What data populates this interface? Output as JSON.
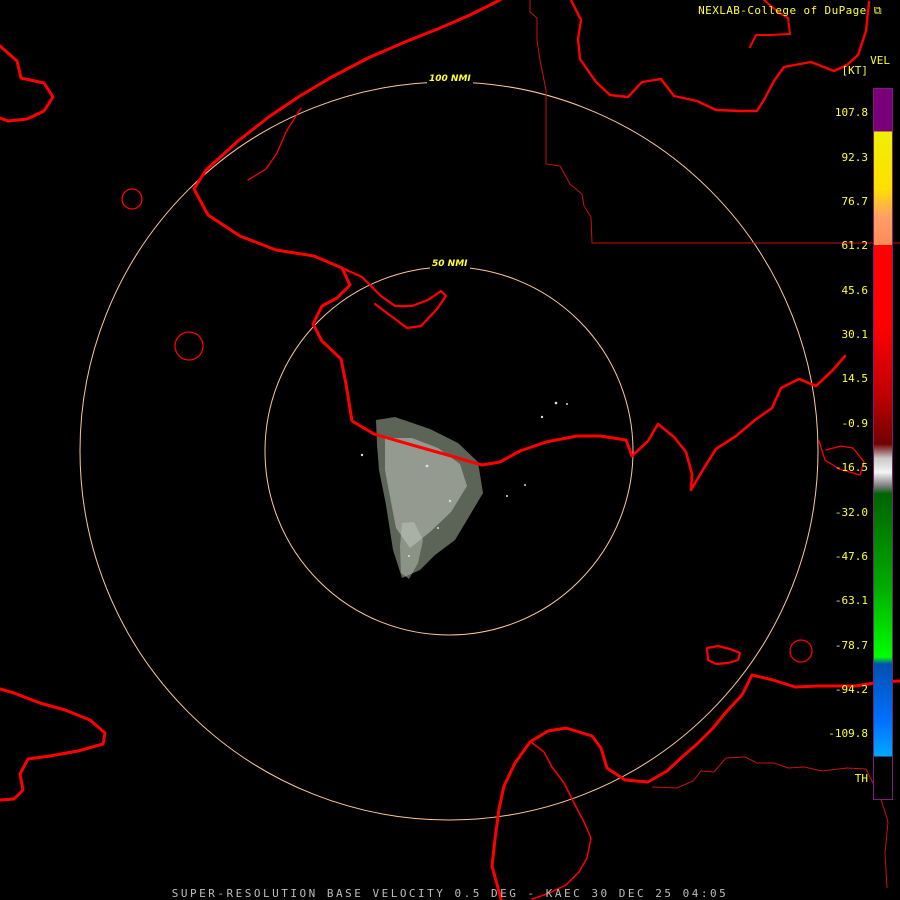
{
  "header": {
    "credit": "NEXLAB-College of DuPage",
    "credit_icon": "external-link-icon"
  },
  "footer": {
    "title": "SUPER-RESOLUTION BASE VELOCITY 0.5 DEG - KAEC 30 DEC 25 04:05"
  },
  "legend": {
    "title": "VEL",
    "unit": "[KT]",
    "labels": [
      "107.8",
      "92.3",
      "76.7",
      "61.2",
      "45.6",
      "30.1",
      "14.5",
      "-0.9",
      "-16.5",
      "-32.0",
      "-47.6",
      "-63.1",
      "-78.7",
      "-94.2",
      "-109.8",
      "TH"
    ]
  },
  "range_rings": [
    {
      "label": "100 NMI"
    },
    {
      "label": "50 NMI"
    }
  ],
  "colors": {
    "coastline": "#ff0000",
    "rings": "#ffc89a",
    "labels": "#ffff33",
    "footer_text": "#bdbdbd"
  }
}
